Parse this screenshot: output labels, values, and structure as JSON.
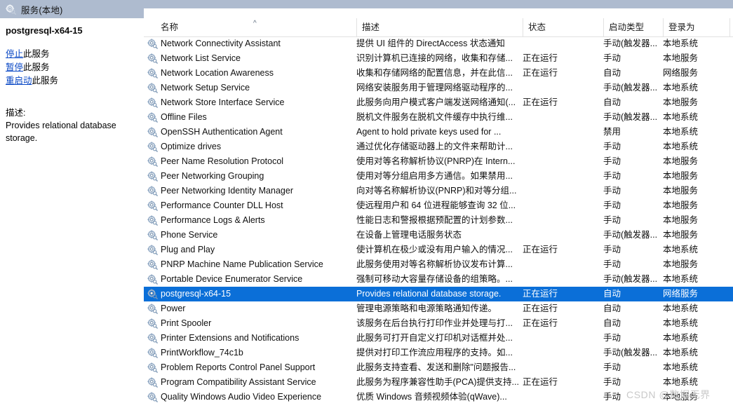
{
  "window": {
    "console_tab_label": "服务(本地)",
    "console_tab_icon": "gear-magnifier-icon"
  },
  "detail_pane": {
    "service_title": "postgresql-x64-15",
    "actions": [
      {
        "link": "停止",
        "rest": "此服务"
      },
      {
        "link": "暂停",
        "rest": "此服务"
      },
      {
        "link": "重启动",
        "rest": "此服务"
      }
    ],
    "description_label": "描述:",
    "description_text": "Provides relational database storage."
  },
  "list": {
    "columns": [
      {
        "key": "name",
        "label": "名称"
      },
      {
        "key": "desc",
        "label": "描述"
      },
      {
        "key": "status",
        "label": "状态"
      },
      {
        "key": "start",
        "label": "启动类型"
      },
      {
        "key": "logon",
        "label": "登录为"
      }
    ],
    "sort_indicator": "^",
    "sorted_by": "名称",
    "rows": [
      {
        "name": "Network Connectivity Assistant",
        "desc": "提供 UI 组件的 DirectAccess 状态通知",
        "status": "",
        "start": "手动(触发器...",
        "logon": "本地系统",
        "selected": false
      },
      {
        "name": "Network List Service",
        "desc": "识别计算机已连接的网络，收集和存储...",
        "status": "正在运行",
        "start": "手动",
        "logon": "本地服务",
        "selected": false
      },
      {
        "name": "Network Location Awareness",
        "desc": "收集和存储网络的配置信息，并在此信...",
        "status": "正在运行",
        "start": "自动",
        "logon": "网络服务",
        "selected": false
      },
      {
        "name": "Network Setup Service",
        "desc": "网络安装服务用于管理网络驱动程序的...",
        "status": "",
        "start": "手动(触发器...",
        "logon": "本地系统",
        "selected": false
      },
      {
        "name": "Network Store Interface Service",
        "desc": "此服务向用户模式客户端发送网络通知(...",
        "status": "正在运行",
        "start": "自动",
        "logon": "本地服务",
        "selected": false
      },
      {
        "name": "Offline Files",
        "desc": "脱机文件服务在脱机文件缓存中执行维...",
        "status": "",
        "start": "手动(触发器...",
        "logon": "本地系统",
        "selected": false
      },
      {
        "name": "OpenSSH Authentication Agent",
        "desc": "Agent to hold private keys used for ...",
        "status": "",
        "start": "禁用",
        "logon": "本地系统",
        "selected": false
      },
      {
        "name": "Optimize drives",
        "desc": "通过优化存储驱动器上的文件来帮助计...",
        "status": "",
        "start": "手动",
        "logon": "本地系统",
        "selected": false
      },
      {
        "name": "Peer Name Resolution Protocol",
        "desc": "使用对等名称解析协议(PNRP)在 Intern...",
        "status": "",
        "start": "手动",
        "logon": "本地服务",
        "selected": false
      },
      {
        "name": "Peer Networking Grouping",
        "desc": "使用对等分组启用多方通信。如果禁用...",
        "status": "",
        "start": "手动",
        "logon": "本地服务",
        "selected": false
      },
      {
        "name": "Peer Networking Identity Manager",
        "desc": "向对等名称解析协议(PNRP)和对等分组...",
        "status": "",
        "start": "手动",
        "logon": "本地服务",
        "selected": false
      },
      {
        "name": "Performance Counter DLL Host",
        "desc": "使远程用户和 64 位进程能够查询 32 位...",
        "status": "",
        "start": "手动",
        "logon": "本地服务",
        "selected": false
      },
      {
        "name": "Performance Logs & Alerts",
        "desc": "性能日志和警报根据预配置的计划参数...",
        "status": "",
        "start": "手动",
        "logon": "本地服务",
        "selected": false
      },
      {
        "name": "Phone Service",
        "desc": "在设备上管理电话服务状态",
        "status": "",
        "start": "手动(触发器...",
        "logon": "本地服务",
        "selected": false
      },
      {
        "name": "Plug and Play",
        "desc": "使计算机在极少或没有用户输入的情况...",
        "status": "正在运行",
        "start": "手动",
        "logon": "本地系统",
        "selected": false
      },
      {
        "name": "PNRP Machine Name Publication Service",
        "desc": "此服务使用对等名称解析协议发布计算...",
        "status": "",
        "start": "手动",
        "logon": "本地服务",
        "selected": false
      },
      {
        "name": "Portable Device Enumerator Service",
        "desc": "强制可移动大容量存储设备的组策略。...",
        "status": "",
        "start": "手动(触发器...",
        "logon": "本地系统",
        "selected": false
      },
      {
        "name": "postgresql-x64-15",
        "desc": "Provides relational database storage.",
        "status": "正在运行",
        "start": "自动",
        "logon": "网络服务",
        "selected": true
      },
      {
        "name": "Power",
        "desc": "管理电源策略和电源策略通知传递。",
        "status": "正在运行",
        "start": "自动",
        "logon": "本地系统",
        "selected": false
      },
      {
        "name": "Print Spooler",
        "desc": "该服务在后台执行打印作业并处理与打...",
        "status": "正在运行",
        "start": "自动",
        "logon": "本地系统",
        "selected": false
      },
      {
        "name": "Printer Extensions and Notifications",
        "desc": "此服务可打开自定义打印机对话框并处...",
        "status": "",
        "start": "手动",
        "logon": "本地系统",
        "selected": false
      },
      {
        "name": "PrintWorkflow_74c1b",
        "desc": "提供对打印工作流应用程序的支持。如...",
        "status": "",
        "start": "手动(触发器...",
        "logon": "本地系统",
        "selected": false
      },
      {
        "name": "Problem Reports Control Panel Support",
        "desc": "此服务支持查看、发送和删除\"问题报告...",
        "status": "",
        "start": "手动",
        "logon": "本地系统",
        "selected": false
      },
      {
        "name": "Program Compatibility Assistant Service",
        "desc": "此服务为程序兼容性助手(PCA)提供支持...",
        "status": "正在运行",
        "start": "手动",
        "logon": "本地系统",
        "selected": false
      },
      {
        "name": "Quality Windows Audio Video Experience",
        "desc": "优质 Windows 音频视频体验(qWave)...",
        "status": "",
        "start": "手动",
        "logon": "本地服务",
        "selected": false
      }
    ]
  },
  "watermark": {
    "text": "CSDN @数据无界"
  },
  "colors": {
    "selection": "#0b6fd8",
    "title_band": "#aebbcf",
    "link": "#0645c4",
    "watermark": "#c9c9c9"
  }
}
